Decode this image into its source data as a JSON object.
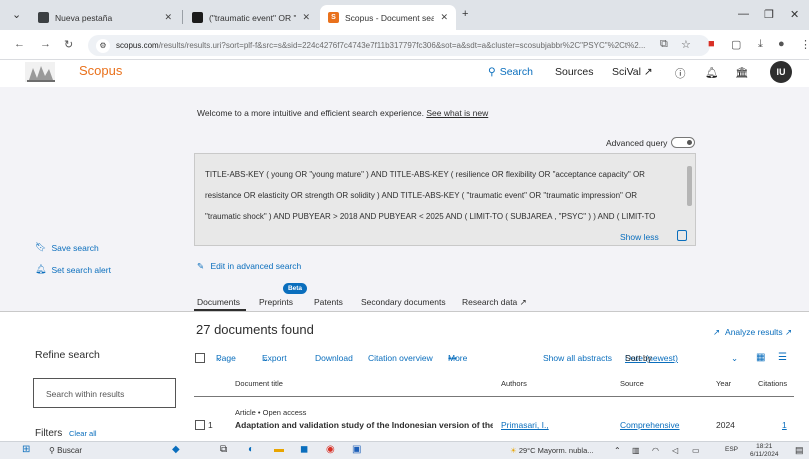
{
  "browser": {
    "tabs": [
      {
        "title": "Nueva pestaña",
        "favicon_color": "#3c4043",
        "favicon_glyph": "◉"
      },
      {
        "title": "(\"traumatic event\" OR \"trauma",
        "favicon_color": "#1b1b1b",
        "favicon_glyph": "▶"
      },
      {
        "title": "Scopus - Document search res",
        "favicon_color": "#e9711c",
        "favicon_glyph": "Sc"
      }
    ],
    "new_tab": "+",
    "url_host": "scopus.com",
    "url_path": "/results/results.uri?sort=plf-f&src=s&sid=224c4276f7c4743e7f11b317797fc306&sot=a&sdt=a&cluster=scosubjabbr%2C\"PSYC\"%2Ct%2..."
  },
  "header": {
    "brand": "Scopus",
    "nav_search": "Search",
    "nav_sources": "Sources",
    "nav_scival": "SciVal ↗",
    "avatar_initials": "IU"
  },
  "welcome": {
    "text": "Welcome to a more intuitive and efficient search experience.",
    "link": "See what is new"
  },
  "advanced_query_label": "Advanced query",
  "query": {
    "line1": "TITLE-ABS-KEY ( young OR \"young mature\" ) AND TITLE-ABS-KEY ( resilience OR flexibility OR \"acceptance capacity\" OR",
    "line2": "resistance OR elasticity OR strength OR solidity ) AND TITLE-ABS-KEY ( \"traumatic event\" OR \"traumatic impression\" OR",
    "line3": "\"traumatic shock\" ) AND PUBYEAR > 2018 AND PUBYEAR < 2025 AND ( LIMIT-TO ( SUBJAREA , \"PSYC\" ) ) AND ( LIMIT-TO",
    "show_less": "Show less"
  },
  "sidebar": {
    "save_search": "Save search",
    "set_alert": "Set search alert",
    "refine": "Refine search",
    "search_within_placeholder": "Search within results",
    "filters": "Filters",
    "clear_all": "Clear all"
  },
  "edit_advanced": "Edit in advanced search",
  "doc_tabs": {
    "beta": "Beta",
    "documents": "Documents",
    "preprints": "Preprints",
    "patents": "Patents",
    "secondary": "Secondary documents",
    "research": "Research data ↗"
  },
  "results": {
    "found": "27 documents found",
    "analyze": "Analyze results ↗"
  },
  "toolbar": {
    "page": "Page",
    "export": "Export",
    "download": "Download",
    "citation_overview": "Citation overview",
    "more": "More",
    "show_all_abstracts": "Show all abstracts",
    "sort_by": "Sort by",
    "sort_value": "Date (newest)"
  },
  "table": {
    "col_title": "Document title",
    "col_authors": "Authors",
    "col_source": "Source",
    "col_year": "Year",
    "col_citations": "Citations"
  },
  "row1": {
    "meta": "Article • Open access",
    "num": "1",
    "title": "Adaptation and validation study of the Indonesian version of the",
    "authors": "Primasari, I.,",
    "source": "Comprehensive",
    "year": "2024",
    "citations": "1"
  },
  "taskbar": {
    "search": "Buscar",
    "weather": "29°C  Mayorm. nubla...",
    "lang": "ESP",
    "time": "18:21",
    "date": "6/11/2024"
  }
}
